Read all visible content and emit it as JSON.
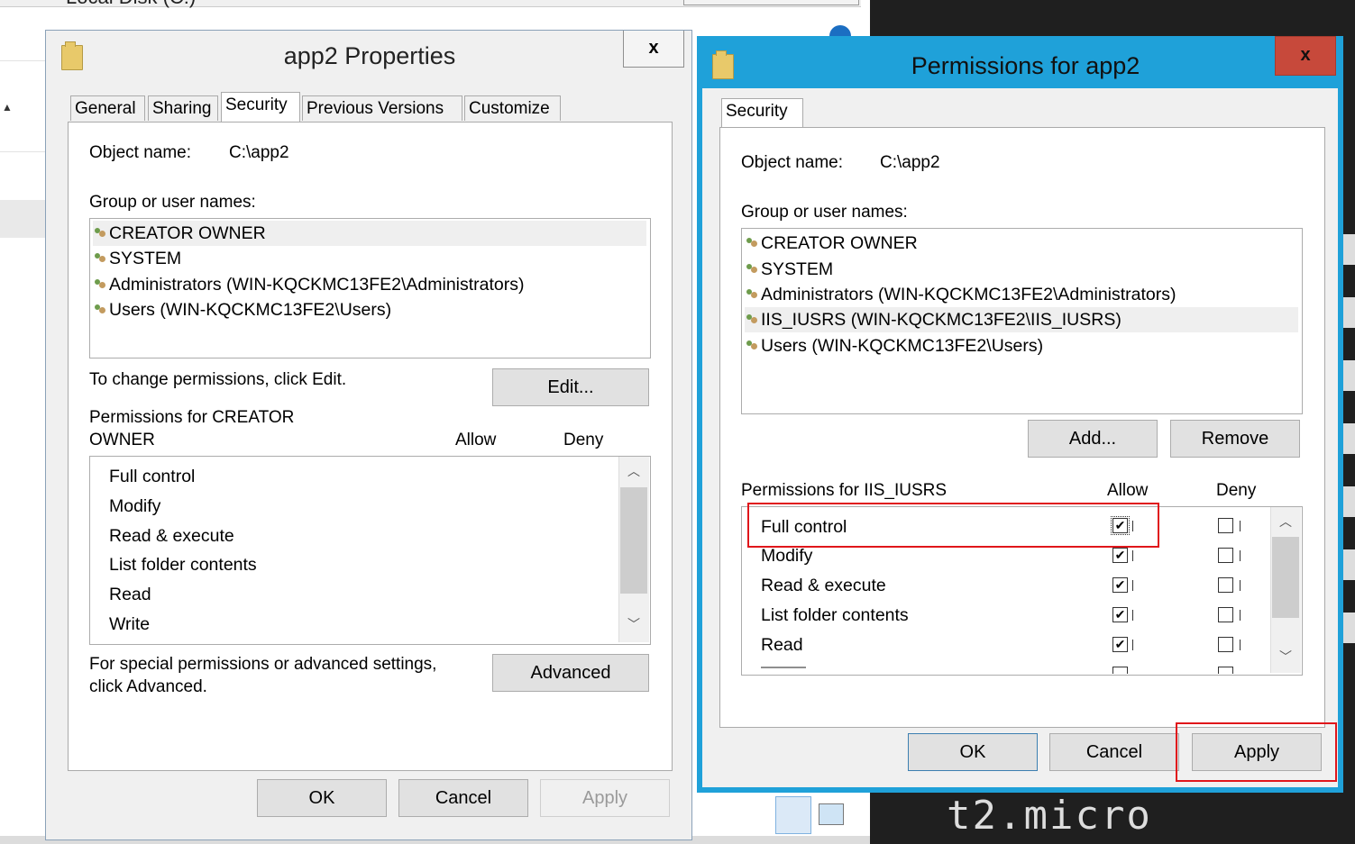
{
  "explorer": {
    "title": "Local Disk (C:)"
  },
  "console": {
    "text": "t2.micro"
  },
  "properties": {
    "title": "app2 Properties",
    "close_glyph": "x",
    "tabs": [
      {
        "label": "General"
      },
      {
        "label": "Sharing"
      },
      {
        "label": "Security"
      },
      {
        "label": "Previous Versions"
      },
      {
        "label": "Customize"
      }
    ],
    "object_name_label": "Object name:",
    "object_name_value": "C:\\app2",
    "group_label": "Group or user names:",
    "users": [
      {
        "name": "CREATOR OWNER"
      },
      {
        "name": "SYSTEM"
      },
      {
        "name": "Administrators (WIN-KQCKMC13FE2\\Administrators)"
      },
      {
        "name": "Users (WIN-KQCKMC13FE2\\Users)"
      }
    ],
    "change_text": "To change permissions, click Edit.",
    "edit_button": "Edit...",
    "perms_for_line1": "Permissions for CREATOR",
    "perms_for_line2": "OWNER",
    "allow_header": "Allow",
    "deny_header": "Deny",
    "permissions": [
      {
        "name": "Full control"
      },
      {
        "name": "Modify"
      },
      {
        "name": "Read & execute"
      },
      {
        "name": "List folder contents"
      },
      {
        "name": "Read"
      },
      {
        "name": "Write"
      }
    ],
    "special_line1": "For special permissions or advanced settings,",
    "special_line2": "click Advanced.",
    "advanced_button": "Advanced",
    "ok_button": "OK",
    "cancel_button": "Cancel",
    "apply_button": "Apply"
  },
  "perm_dialog": {
    "title": "Permissions for app2",
    "close_glyph": "x",
    "tab": "Security",
    "object_name_label": "Object name:",
    "object_name_value": "C:\\app2",
    "group_label": "Group or user names:",
    "users": [
      {
        "name": "CREATOR OWNER"
      },
      {
        "name": "SYSTEM"
      },
      {
        "name": "Administrators (WIN-KQCKMC13FE2\\Administrators)"
      },
      {
        "name": "IIS_IUSRS (WIN-KQCKMC13FE2\\IIS_IUSRS)"
      },
      {
        "name": "Users (WIN-KQCKMC13FE2\\Users)"
      }
    ],
    "selected_user": "IIS_IUSRS (WIN-KQCKMC13FE2\\IIS_IUSRS)",
    "add_button": "Add...",
    "remove_button": "Remove",
    "perms_for": "Permissions for IIS_IUSRS",
    "allow_header": "Allow",
    "deny_header": "Deny",
    "permissions": [
      {
        "name": "Full control",
        "allow": true,
        "deny": false
      },
      {
        "name": "Modify",
        "allow": true,
        "deny": false
      },
      {
        "name": "Read & execute",
        "allow": true,
        "deny": false
      },
      {
        "name": "List folder contents",
        "allow": true,
        "deny": false
      },
      {
        "name": "Read",
        "allow": true,
        "deny": false
      }
    ],
    "check_glyph": "✔",
    "ok_button": "OK",
    "cancel_button": "Cancel",
    "apply_button": "Apply"
  },
  "colors": {
    "highlight_red": "#e0161b",
    "active_border": "#1fa1d9",
    "close_red": "#c7493b"
  }
}
